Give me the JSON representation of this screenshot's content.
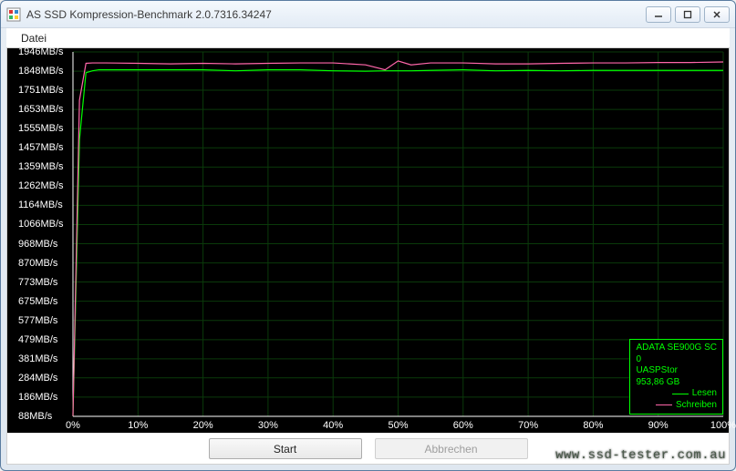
{
  "window": {
    "title": "AS SSD Kompression-Benchmark 2.0.7316.34247"
  },
  "menu": {
    "file": "Datei"
  },
  "buttons": {
    "start": "Start",
    "cancel": "Abbrechen"
  },
  "legend": {
    "device": "ADATA SE900G SC",
    "device_line2": "0",
    "driver": "UASPStor",
    "capacity": "953,86 GB",
    "read": "Lesen",
    "write": "Schreiben"
  },
  "watermark": "www.ssd-tester.com.au",
  "chart_data": {
    "type": "line",
    "xlabel": "",
    "ylabel": "",
    "x_unit": "%",
    "y_unit": "MB/s",
    "xlim": [
      0,
      100
    ],
    "ylim": [
      88,
      1946
    ],
    "x_ticks": [
      0,
      10,
      20,
      30,
      40,
      50,
      60,
      70,
      80,
      90,
      100
    ],
    "y_ticks": [
      88,
      186,
      284,
      381,
      479,
      577,
      675,
      773,
      870,
      968,
      1066,
      1164,
      1262,
      1359,
      1457,
      1555,
      1653,
      1751,
      1848,
      1946
    ],
    "categories": [
      0,
      1,
      2,
      3,
      4,
      5,
      10,
      15,
      20,
      25,
      30,
      35,
      40,
      45,
      48,
      50,
      52,
      55,
      60,
      65,
      70,
      75,
      80,
      85,
      90,
      95,
      100
    ],
    "series": [
      {
        "name": "Lesen",
        "color": "#00ff00",
        "values": [
          90,
          1500,
          1840,
          1850,
          1855,
          1855,
          1855,
          1855,
          1855,
          1850,
          1855,
          1855,
          1850,
          1848,
          1850,
          1850,
          1850,
          1852,
          1855,
          1850,
          1852,
          1850,
          1852,
          1852,
          1852,
          1852,
          1852
        ]
      },
      {
        "name": "Schreiben",
        "color": "#ff66aa",
        "values": [
          90,
          1700,
          1888,
          1890,
          1890,
          1890,
          1888,
          1885,
          1888,
          1885,
          1888,
          1890,
          1890,
          1880,
          1855,
          1900,
          1880,
          1890,
          1890,
          1885,
          1885,
          1888,
          1890,
          1890,
          1892,
          1892,
          1895
        ]
      }
    ]
  }
}
